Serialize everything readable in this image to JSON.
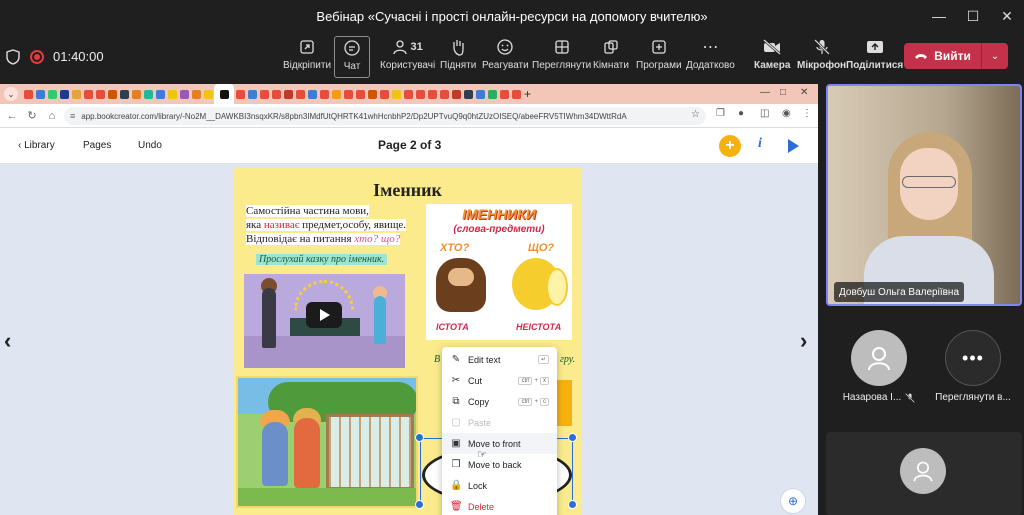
{
  "window": {
    "title": "Вебінар «Сучасні і прості онлайн-ресурси на допомогу вчителю»",
    "controls": [
      "minimize",
      "maximize",
      "close"
    ]
  },
  "meeting_toolbar": {
    "timer": "01:40:00",
    "buttons": [
      {
        "id": "undock",
        "label": "Відкріпити",
        "icon": "undock-icon"
      },
      {
        "id": "chat",
        "label": "Чат",
        "icon": "chat-icon",
        "active": true
      },
      {
        "id": "people",
        "label": "Користувачі",
        "icon": "people-icon",
        "count": "31"
      },
      {
        "id": "raise",
        "label": "Підняти",
        "icon": "raise-hand-icon"
      },
      {
        "id": "react",
        "label": "Реагувати",
        "icon": "emoji-icon"
      },
      {
        "id": "view",
        "label": "Переглянути",
        "icon": "grid-view-icon"
      },
      {
        "id": "rooms",
        "label": "Кімнати",
        "icon": "rooms-icon"
      },
      {
        "id": "apps",
        "label": "Програми",
        "icon": "apps-icon"
      },
      {
        "id": "more",
        "label": "Додатково",
        "icon": "more-icon"
      },
      {
        "id": "camera",
        "label": "Камера",
        "icon": "camera-off-icon"
      },
      {
        "id": "mic",
        "label": "Мікрофон",
        "icon": "mic-off-icon"
      },
      {
        "id": "share",
        "label": "Поділитися",
        "icon": "share-icon"
      }
    ],
    "leave_label": "Вийти",
    "leave_color": "#c4314b"
  },
  "browser": {
    "url": "app.bookcreator.com/library/-No2M__DAWKBI3nsqxKR/s8pbn3IMdfUtQHRTK41whHcnbhP2/Dp2UPTvuQ9q0htZUzOISEQ/abeeFRV5TIWhm34DWttRdA",
    "tab_colors": [
      "#e74c3c",
      "#3b7dd8",
      "#2ecc71",
      "#1a3c8f",
      "#e6a23c",
      "#e74c3c",
      "#e74c3c",
      "#d35400",
      "#2c3e50",
      "#e67e22",
      "#1abc9c",
      "#3b7dd8",
      "#f1c40f",
      "#9b59b6",
      "#e67e22",
      "#f1c40f",
      "#111111",
      "#e74c3c",
      "#3b7dd8",
      "#e74c3c",
      "#e74c3c",
      "#c0392b",
      "#e74c3c",
      "#3b7dd8",
      "#e74c3c",
      "#f39c12",
      "#e74c3c",
      "#e74c3c",
      "#d35400",
      "#e74c3c",
      "#f1c40f",
      "#e74c3c",
      "#e74c3c",
      "#e74c3c",
      "#e74c3c",
      "#c0392b",
      "#2c3e50",
      "#3b7dd8",
      "#27ae60",
      "#e74c3c",
      "#e74c3c"
    ]
  },
  "bookcreator": {
    "library_label": "Library",
    "pages_label": "Pages",
    "undo_label": "Undo",
    "page_indicator": "Page 2 of 3",
    "accent": "#f5b10f"
  },
  "book_page": {
    "title": "Іменник",
    "definition_line1": "Самостійна частина мови,",
    "definition_line2_pre": "яка ",
    "definition_line2_red": "називає",
    "definition_line2_post": " предмет,особу, явище.",
    "definition_line3_pre": "Відповідає на питання ",
    "definition_line3_q": "хто? що?",
    "listen_caption": "Прослухай казку про іменник.",
    "poster_title": "ІМЕННИКИ",
    "poster_subtitle": "(слова-предмети)",
    "poster_q1": "ХТО?",
    "poster_q2": "ЩО?",
    "poster_a1": "ІСТОТА",
    "poster_a2": "НЕІСТОТА",
    "caption_partial_left": "В",
    "caption_partial_right": "гру."
  },
  "context_menu": {
    "items": [
      {
        "label": "Edit text",
        "icon": "pencil-icon",
        "keys": [
          "↵"
        ]
      },
      {
        "label": "Cut",
        "icon": "scissors-icon",
        "keys": [
          "ctrl",
          "+",
          "x"
        ]
      },
      {
        "label": "Copy",
        "icon": "copy-icon",
        "keys": [
          "ctrl",
          "+",
          "c"
        ]
      },
      {
        "label": "Paste",
        "icon": "paste-icon",
        "disabled": true
      },
      {
        "label": "Move to front",
        "icon": "bring-front-icon",
        "hover": true
      },
      {
        "label": "Move to back",
        "icon": "send-back-icon"
      },
      {
        "label": "Lock",
        "icon": "lock-icon"
      },
      {
        "label": "Delete",
        "icon": "trash-icon",
        "danger": true
      }
    ]
  },
  "participants": {
    "speaker_name": "Довбуш Ольга Валеріївна",
    "tiles": [
      {
        "name": "Назарова І...",
        "muted": true
      },
      {
        "name": "Переглянути в..."
      }
    ]
  }
}
